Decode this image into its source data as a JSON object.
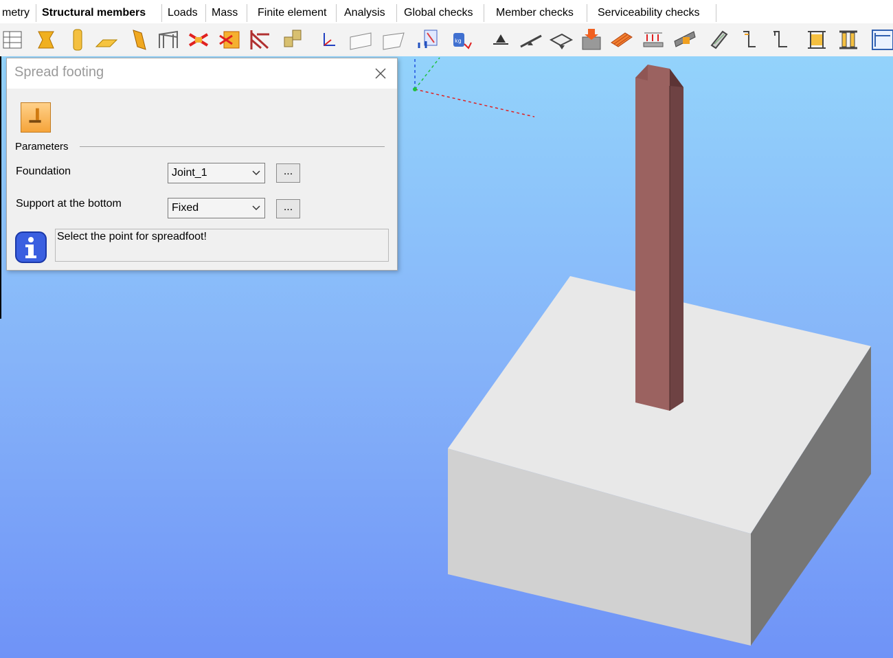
{
  "tabs": [
    {
      "label": "metry",
      "active": false
    },
    {
      "label": "Structural members",
      "active": true
    },
    {
      "label": "Loads",
      "active": false
    },
    {
      "label": "Mass",
      "active": false
    },
    {
      "label": "Finite element",
      "active": false
    },
    {
      "label": "Analysis",
      "active": false
    },
    {
      "label": "Global checks",
      "active": false
    },
    {
      "label": "Member checks",
      "active": false
    },
    {
      "label": "Serviceability checks",
      "active": false
    }
  ],
  "toolbar": {
    "icons": [
      "table-icon",
      "beam-section-icon",
      "column-icon",
      "slab-icon",
      "wall-icon",
      "frame-icon",
      "bracing-icon",
      "multi-bracing-icon",
      "truss-icon",
      "grid-icon",
      "axis-icon",
      "plane-icon",
      "plane-2-icon",
      "spread-footing-icon",
      "mass-icon",
      "support-icon",
      "hinge-icon",
      "plate-support-icon",
      "load-block-icon",
      "distributed-load-icon",
      "area-load-icon",
      "member-load-icon",
      "stiffener-icon",
      "z-profile-icon",
      "z-profile-2-icon",
      "c-section-icon",
      "i-section-icon",
      "beam-icon"
    ]
  },
  "dialog": {
    "title": "Spread footing",
    "close_icon": "close-icon",
    "tool_icon": "spread-footing-icon",
    "group_label": "Parameters",
    "fields": [
      {
        "label": "Foundation",
        "value": "Joint_1",
        "more": "..."
      },
      {
        "label": "Support at the bottom",
        "value": "Fixed",
        "more": "..."
      }
    ],
    "info_icon": "info-icon",
    "message": "Select the point for spreadfoot!"
  },
  "scene": {
    "objects": [
      "concrete-footing",
      "steel-i-column",
      "coordinate-axes"
    ],
    "colors": {
      "footing_top": "#e8e8e8",
      "footing_front": "#d1d1d1",
      "footing_side": "#767676",
      "column": "#9b6260",
      "column_dark": "#5c3435"
    }
  }
}
